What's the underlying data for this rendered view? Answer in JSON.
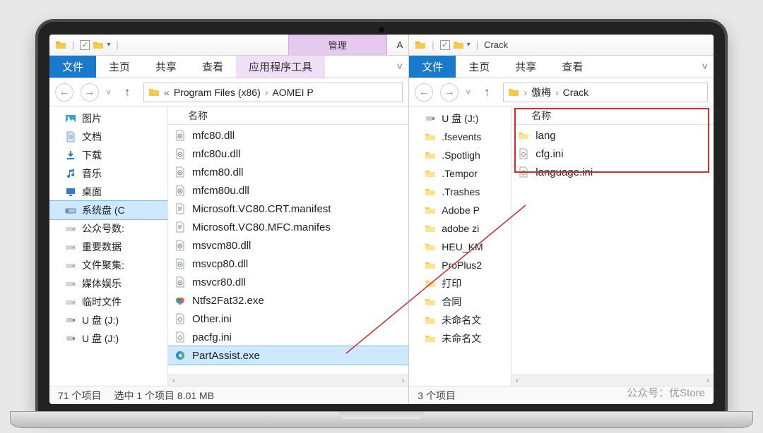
{
  "left": {
    "qat_checked": "✓",
    "ribbon_contextual": "管理",
    "title_suffix": "A",
    "tabs": {
      "file": "文件",
      "home": "主页",
      "share": "共享",
      "view": "查看",
      "context": "应用程序工具"
    },
    "breadcrumbs": {
      "prefix": "«",
      "parts": [
        "Program Files (x86)",
        "AOMEI P"
      ]
    },
    "nav": [
      {
        "label": "图片",
        "icon": "pictures"
      },
      {
        "label": "文档",
        "icon": "doc"
      },
      {
        "label": "下载",
        "icon": "download"
      },
      {
        "label": "音乐",
        "icon": "music"
      },
      {
        "label": "桌面",
        "icon": "desktop"
      },
      {
        "label": "系统盘 (C",
        "icon": "drive",
        "selected": true
      },
      {
        "label": "公众号数:",
        "icon": "drive2"
      },
      {
        "label": "重要数据",
        "icon": "drive2"
      },
      {
        "label": "文件聚集:",
        "icon": "drive2"
      },
      {
        "label": "媒体娱乐",
        "icon": "drive2"
      },
      {
        "label": "临时文件",
        "icon": "drive2"
      },
      {
        "label": "U 盘 (J:)",
        "icon": "usb"
      },
      {
        "label": "U 盘 (J:)",
        "icon": "usb"
      }
    ],
    "column_header": "名称",
    "files": [
      {
        "name": "mfc80.dll",
        "icon": "dll",
        "cut": true
      },
      {
        "name": "mfc80u.dll",
        "icon": "dll"
      },
      {
        "name": "mfcm80.dll",
        "icon": "dll"
      },
      {
        "name": "mfcm80u.dll",
        "icon": "dll"
      },
      {
        "name": "Microsoft.VC80.CRT.manifest",
        "icon": "manifest"
      },
      {
        "name": "Microsoft.VC80.MFC.manifes",
        "icon": "manifest"
      },
      {
        "name": "msvcm80.dll",
        "icon": "dll"
      },
      {
        "name": "msvcp80.dll",
        "icon": "dll"
      },
      {
        "name": "msvcr80.dll",
        "icon": "dll"
      },
      {
        "name": "Ntfs2Fat32.exe",
        "icon": "exe-colored"
      },
      {
        "name": "Other.ini",
        "icon": "ini"
      },
      {
        "name": "pacfg.ini",
        "icon": "ini"
      },
      {
        "name": "PartAssist.exe",
        "icon": "exe-pa",
        "selected": true
      }
    ],
    "status": {
      "count": "71 个项目",
      "selection": "选中 1 个项目 8.01 MB"
    }
  },
  "right": {
    "qat_checked": "✓",
    "title": "Crack",
    "tabs": {
      "file": "文件",
      "home": "主页",
      "share": "共享",
      "view": "查看"
    },
    "breadcrumbs": {
      "parts": [
        "傲梅",
        "Crack"
      ]
    },
    "nav": [
      {
        "label": "U 盘 (J:)",
        "icon": "usb"
      },
      {
        "label": ".fsevents",
        "icon": "folder"
      },
      {
        "label": ".Spotligh",
        "icon": "folder"
      },
      {
        "label": ".Tempor",
        "icon": "folder"
      },
      {
        "label": ".Trashes",
        "icon": "folder"
      },
      {
        "label": "Adobe P",
        "icon": "folder"
      },
      {
        "label": "adobe zi",
        "icon": "folder"
      },
      {
        "label": "HEU_KM",
        "icon": "folder"
      },
      {
        "label": "ProPlus2",
        "icon": "folder"
      },
      {
        "label": "打印",
        "icon": "folder"
      },
      {
        "label": "合同",
        "icon": "folder"
      },
      {
        "label": "未命名文",
        "icon": "folder"
      },
      {
        "label": "未命名文",
        "icon": "folder"
      }
    ],
    "column_header": "名称",
    "files": [
      {
        "name": "lang",
        "icon": "folder"
      },
      {
        "name": "cfg.ini",
        "icon": "ini"
      },
      {
        "name": "language.ini",
        "icon": "ini"
      }
    ],
    "status": {
      "count": "3 个项目"
    }
  },
  "watermark": "公众号：优Store"
}
